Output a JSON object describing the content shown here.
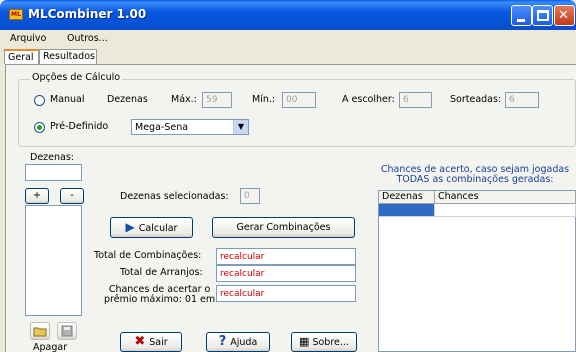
{
  "window": {
    "title": "MLCombiner 1.00",
    "app_icon_text": "ML"
  },
  "menu": [
    "Arquivo",
    "Outros..."
  ],
  "tabs": [
    "Geral",
    "Resultados"
  ],
  "options": {
    "group_title": "Opções de Cálculo",
    "manual_label": "Manual",
    "dezenas_label": "Dezenas",
    "max_label": "Máx.:",
    "max_value": "59",
    "min_label": "Mín.:",
    "min_value": "00",
    "escolher_label": "A escolher:",
    "escolher_value": "6",
    "sorteadas_label": "Sorteadas:",
    "sorteadas_value": "6",
    "predefinido_label": "Pré-Definido",
    "lottery_selected": "Mega-Sena"
  },
  "left": {
    "dezenas_label": "Dezenas:",
    "plus": "+",
    "minus": "-",
    "apagar": "Apagar"
  },
  "center": {
    "selecionadas_label": "Dezenas selecionadas:",
    "selecionadas_value": "0",
    "calcular": "Calcular",
    "gerar": "Gerar Combinações",
    "total_comb_label": "Total de Combinações:",
    "total_comb_value": "recalcular",
    "total_arranjos_label": "Total de Arranjos:",
    "total_arranjos_value": "recalcular",
    "chances_label_1": "Chances de acertar o",
    "chances_label_2": "prêmio máximo: 01 em",
    "chances_value": "recalcular"
  },
  "right": {
    "heading_1": "Chances de acerto, caso sejam jogadas",
    "heading_2": "TODAS as combinações geradas:",
    "columns": [
      "Dezenas",
      "Chances"
    ]
  },
  "bottom": {
    "sair": "Sair",
    "ajuda": "Ajuda",
    "sobre": "Sobre..."
  },
  "colors": {
    "accent": "#0857e1",
    "warning_text": "#d00000",
    "info_text": "#1a3f98"
  }
}
